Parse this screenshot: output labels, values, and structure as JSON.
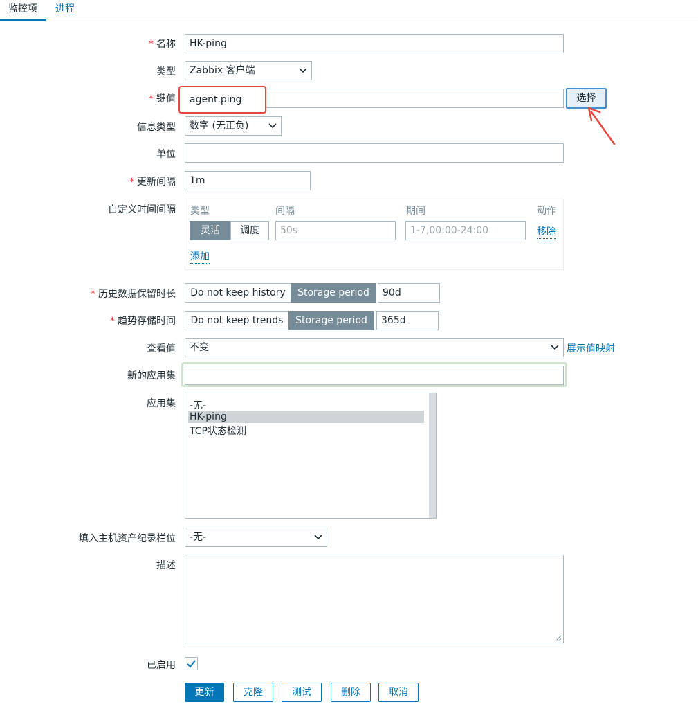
{
  "tabs": {
    "active": "监控项",
    "other": "进程"
  },
  "form": {
    "name": {
      "label": "名称",
      "value": "HK-ping"
    },
    "type": {
      "label": "类型",
      "value": "Zabbix 客户端"
    },
    "key": {
      "label": "键值",
      "value": "agent.ping",
      "select_button": "选择"
    },
    "info_type": {
      "label": "信息类型",
      "value": "数字 (无正负)"
    },
    "units": {
      "label": "单位",
      "value": ""
    },
    "update_interval": {
      "label": "更新间隔",
      "value": "1m"
    },
    "custom_intervals": {
      "label": "自定义时间间隔",
      "col_type": "类型",
      "col_interval": "间隔",
      "col_period": "期间",
      "col_action": "动作",
      "mode_flexible": "灵活",
      "mode_scheduling": "调度",
      "interval_placeholder": "50s",
      "period_placeholder": "1-7,00:00-24:00",
      "remove": "移除",
      "add": "添加"
    },
    "history": {
      "label": "历史数据保留时长",
      "no_keep": "Do not keep history",
      "storage": "Storage period",
      "value": "90d"
    },
    "trends": {
      "label": "趋势存储时间",
      "no_keep": "Do not keep trends",
      "storage": "Storage period",
      "value": "365d"
    },
    "show_value": {
      "label": "查看值",
      "value": "不变",
      "link": "展示值映射"
    },
    "new_application": {
      "label": "新的应用集",
      "value": ""
    },
    "applications": {
      "label": "应用集",
      "items": [
        "-无-",
        "HK-ping",
        "TCP状态检测"
      ],
      "selected_index": 1
    },
    "inventory": {
      "label": "填入主机资产纪录栏位",
      "value": "-无-"
    },
    "description": {
      "label": "描述",
      "value": ""
    },
    "enabled": {
      "label": "已启用",
      "checked": true
    }
  },
  "buttons": {
    "update": "更新",
    "clone": "克隆",
    "test": "测试",
    "delete": "删除",
    "cancel": "取消"
  },
  "colors": {
    "accent": "#0275b8",
    "highlight": "#e8453c",
    "segment_on": "#768d99"
  }
}
